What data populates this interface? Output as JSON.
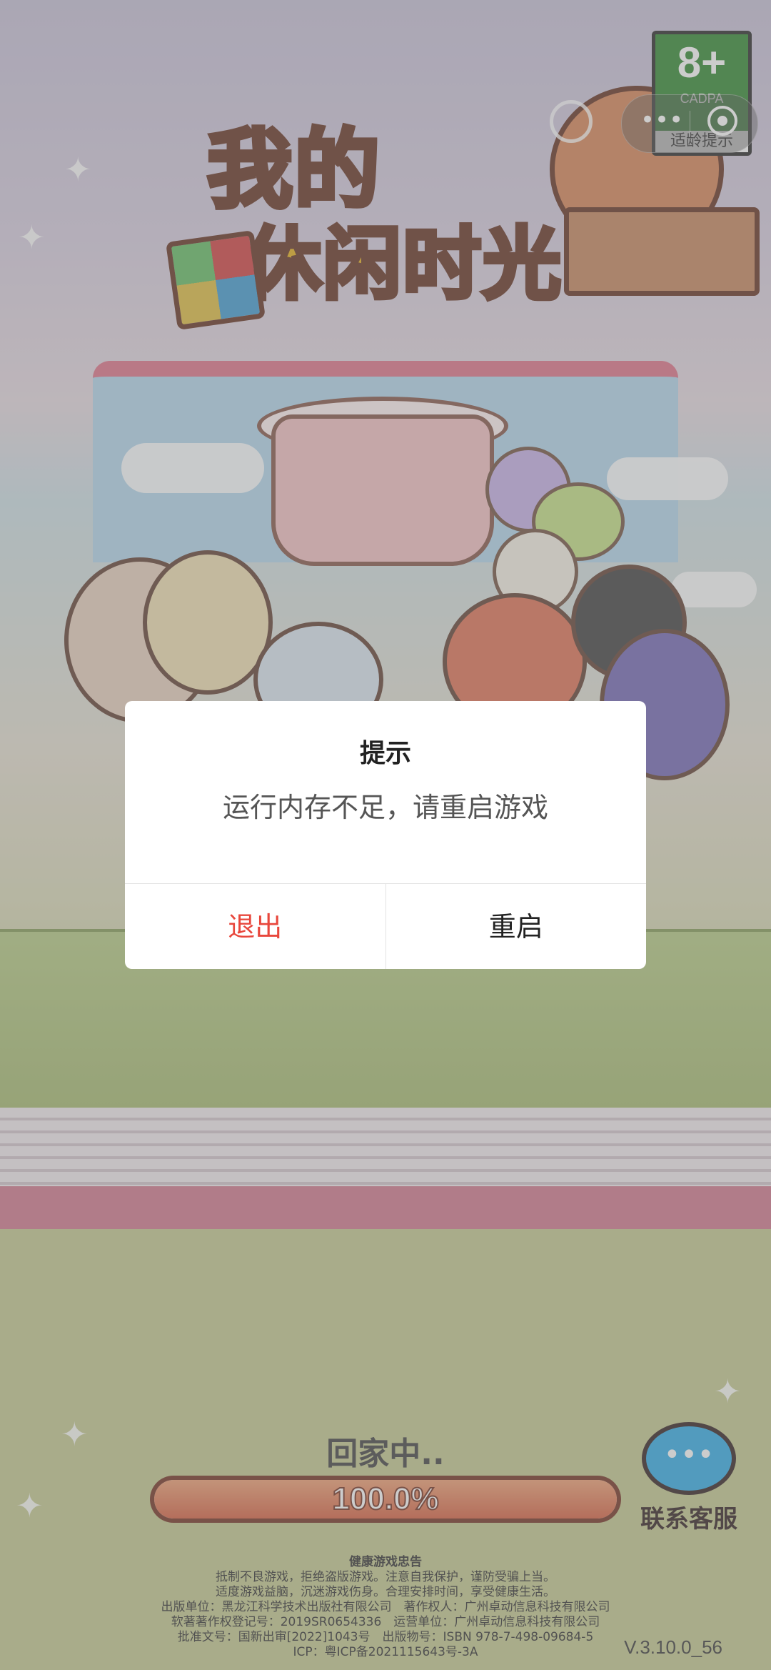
{
  "game": {
    "logo_line1": "我的",
    "logo_line2": "休闲时光"
  },
  "age_rating": {
    "value": "8+",
    "org": "CADPA",
    "label": "适龄提示"
  },
  "capsule": {
    "more_icon": "ellipsis-icon",
    "close_icon": "target-close-icon"
  },
  "loading": {
    "status": "回家中..",
    "progress_text": "100.0%",
    "progress_fraction": 1.0
  },
  "customer_service": {
    "label": "联系客服",
    "icon": "chat-bubble-icon"
  },
  "health_notice": {
    "title": "健康游戏忠告",
    "lines": [
      "抵制不良游戏，拒绝盗版游戏。注意自我保护，谨防受骗上当。",
      "适度游戏益脑，沉迷游戏伤身。合理安排时间，享受健康生活。"
    ]
  },
  "publisher_info": [
    "出版单位：黑龙江科学技术出版社有限公司　著作权人：广州卓动信息科技有限公司",
    "软著著作权登记号：2019SR0654336　运营单位：广州卓动信息科技有限公司",
    "批准文号：国新出审[2022]1043号　出版物号：ISBN 978-7-498-09684-5",
    "ICP：粤ICP备2021115643号-3A"
  ],
  "version": "V.3.10.0_56",
  "dialog": {
    "title": "提示",
    "message": "运行内存不足，请重启游戏",
    "exit_label": "退出",
    "restart_label": "重启"
  },
  "colors": {
    "exit": "#e8473c",
    "progress_fill": "#d9684a",
    "badge_green": "#3a8f3a"
  }
}
